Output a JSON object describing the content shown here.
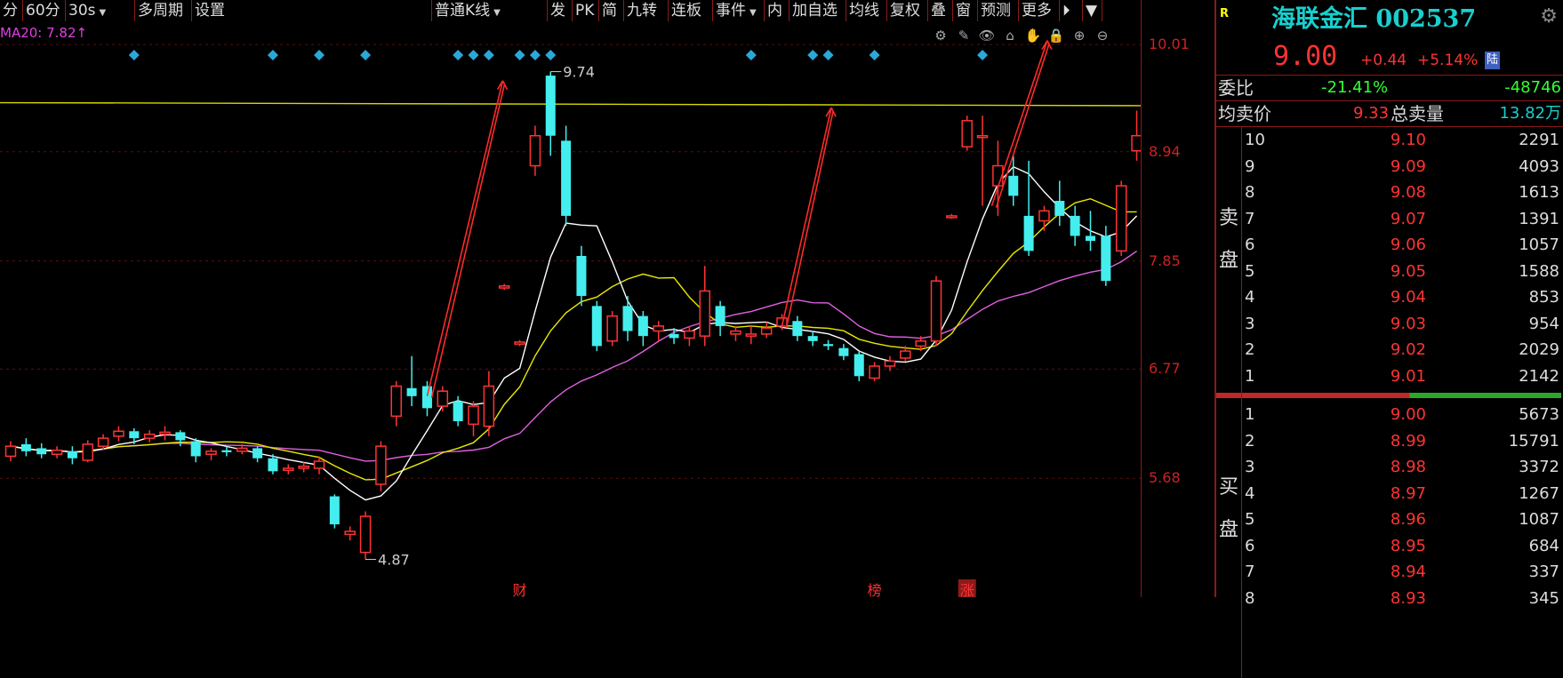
{
  "toolbar": {
    "items": [
      {
        "label": "分",
        "w": 26
      },
      {
        "label": "60分",
        "w": 48
      },
      {
        "label": "30s",
        "w": 78,
        "dd": true
      },
      {
        "label": "多周期",
        "w": 64
      },
      {
        "label": "设置",
        "w": 270
      },
      {
        "label": "普通K线",
        "w": 130,
        "dd": true
      },
      {
        "label": "发",
        "w": 28
      },
      {
        "label": "PK",
        "w": 30
      },
      {
        "label": "简",
        "w": 28
      },
      {
        "label": "九转",
        "w": 50
      },
      {
        "label": "连板",
        "w": 50
      },
      {
        "label": "事件",
        "w": 58,
        "dd": true
      },
      {
        "label": "内",
        "w": 28
      },
      {
        "label": "加自选",
        "w": 64
      },
      {
        "label": "均线",
        "w": 46
      },
      {
        "label": "复权",
        "w": 46
      },
      {
        "label": "叠",
        "w": 28
      },
      {
        "label": "窗",
        "w": 28
      },
      {
        "label": "预测",
        "w": 46
      },
      {
        "label": "更多",
        "w": 46
      },
      {
        "label": "⏵",
        "w": 26
      },
      {
        "label": "▼",
        "w": 22
      }
    ]
  },
  "ma_label": "MA20: 7.82↑",
  "tool_icons": [
    "⚙",
    "✎",
    "👁",
    "⌂",
    "✋",
    "🔒",
    "⊕",
    "⊖"
  ],
  "tool_icon_names": [
    "gear-icon",
    "pen-icon",
    "eye-icon",
    "home-icon",
    "hand-icon",
    "lock-icon",
    "zoom-in-icon",
    "zoom-out-icon"
  ],
  "axis": {
    "min": 4.6,
    "max": 10.1,
    "ticks": [
      {
        "v": 10.01,
        "label": "10.01"
      },
      {
        "v": 8.94,
        "label": "8.94"
      },
      {
        "v": 7.85,
        "label": "7.85"
      },
      {
        "v": 6.77,
        "label": "6.77"
      },
      {
        "v": 5.68,
        "label": "5.68"
      }
    ]
  },
  "chart_data": {
    "type": "candlestick",
    "colors": {
      "up": "#ff3333",
      "down": "#44eeee",
      "ma5": "#ffffff",
      "ma10": "#e8e800",
      "ma20": "#e060e0",
      "yellow_line": "#d8d800"
    },
    "high_label": "9.74",
    "low_label": "4.87",
    "event_markers": [
      "财",
      "榜",
      "涨"
    ],
    "candles": [
      [
        5.9,
        6.0,
        6.05,
        5.85
      ],
      [
        6.02,
        5.95,
        6.08,
        5.9
      ],
      [
        5.98,
        5.92,
        6.03,
        5.88
      ],
      [
        5.92,
        5.96,
        6.0,
        5.88
      ],
      [
        5.95,
        5.88,
        6.0,
        5.82
      ],
      [
        5.86,
        6.02,
        6.06,
        5.84
      ],
      [
        6.0,
        6.08,
        6.12,
        5.96
      ],
      [
        6.1,
        6.15,
        6.2,
        6.05
      ],
      [
        6.15,
        6.08,
        6.18,
        6.02
      ],
      [
        6.08,
        6.12,
        6.16,
        6.04
      ],
      [
        6.12,
        6.14,
        6.2,
        6.06
      ],
      [
        6.14,
        6.06,
        6.16,
        6.0
      ],
      [
        6.05,
        5.9,
        6.08,
        5.84
      ],
      [
        5.92,
        5.95,
        5.98,
        5.86
      ],
      [
        5.96,
        5.94,
        6.0,
        5.9
      ],
      [
        5.95,
        5.98,
        6.02,
        5.92
      ],
      [
        5.98,
        5.88,
        6.0,
        5.84
      ],
      [
        5.88,
        5.75,
        5.92,
        5.72
      ],
      [
        5.76,
        5.78,
        5.82,
        5.72
      ],
      [
        5.78,
        5.8,
        5.84,
        5.74
      ],
      [
        5.78,
        5.85,
        5.9,
        5.72
      ],
      [
        5.5,
        5.22,
        5.52,
        5.18
      ],
      [
        5.12,
        5.15,
        5.2,
        5.06
      ],
      [
        4.94,
        5.3,
        5.35,
        4.87
      ],
      [
        5.62,
        6.0,
        6.05,
        5.55
      ],
      [
        6.3,
        6.6,
        6.65,
        6.2
      ],
      [
        6.58,
        6.5,
        6.9,
        6.4
      ],
      [
        6.6,
        6.38,
        6.65,
        6.3
      ],
      [
        6.4,
        6.55,
        6.6,
        6.35
      ],
      [
        6.45,
        6.25,
        6.5,
        6.2
      ],
      [
        6.22,
        6.4,
        6.45,
        6.1
      ],
      [
        6.2,
        6.6,
        6.75,
        6.1
      ],
      [
        7.58,
        7.6,
        7.62,
        7.56
      ],
      [
        7.02,
        7.04,
        7.06,
        7.0
      ],
      [
        8.8,
        9.1,
        9.2,
        8.7
      ],
      [
        9.7,
        9.1,
        9.74,
        8.9
      ],
      [
        9.05,
        8.3,
        9.2,
        8.2
      ],
      [
        7.9,
        7.5,
        8.0,
        7.4
      ],
      [
        7.4,
        7.0,
        7.45,
        6.95
      ],
      [
        7.05,
        7.3,
        7.35,
        7.0
      ],
      [
        7.4,
        7.15,
        7.5,
        7.05
      ],
      [
        7.3,
        7.1,
        7.35,
        7.0
      ],
      [
        7.15,
        7.2,
        7.25,
        7.05
      ],
      [
        7.12,
        7.08,
        7.18,
        7.02
      ],
      [
        7.08,
        7.15,
        7.2,
        7.0
      ],
      [
        7.1,
        7.55,
        7.8,
        7.0
      ],
      [
        7.4,
        7.2,
        7.45,
        7.1
      ],
      [
        7.12,
        7.15,
        7.2,
        7.05
      ],
      [
        7.1,
        7.12,
        7.2,
        7.02
      ],
      [
        7.12,
        7.18,
        7.24,
        7.08
      ],
      [
        7.2,
        7.28,
        7.32,
        7.16
      ],
      [
        7.25,
        7.1,
        7.3,
        7.05
      ],
      [
        7.1,
        7.05,
        7.15,
        7.0
      ],
      [
        7.02,
        7.0,
        7.06,
        6.96
      ],
      [
        6.98,
        6.9,
        7.02,
        6.86
      ],
      [
        6.92,
        6.7,
        6.95,
        6.65
      ],
      [
        6.68,
        6.8,
        6.84,
        6.65
      ],
      [
        6.8,
        6.85,
        6.9,
        6.75
      ],
      [
        6.88,
        6.95,
        7.0,
        6.85
      ],
      [
        7.0,
        7.05,
        7.1,
        6.95
      ],
      [
        7.05,
        7.65,
        7.7,
        7.0
      ],
      [
        8.29,
        8.3,
        8.32,
        8.27
      ],
      [
        8.99,
        9.25,
        9.3,
        8.95
      ],
      [
        9.1,
        9.1,
        9.3,
        8.4
      ],
      [
        8.6,
        8.8,
        9.05,
        8.3
      ],
      [
        8.7,
        8.5,
        8.9,
        8.4
      ],
      [
        8.3,
        7.95,
        8.85,
        7.9
      ],
      [
        8.25,
        8.35,
        8.4,
        8.15
      ],
      [
        8.45,
        8.3,
        8.65,
        8.2
      ],
      [
        8.3,
        8.1,
        8.4,
        8.0
      ],
      [
        8.1,
        8.05,
        8.35,
        7.95
      ],
      [
        8.1,
        7.65,
        8.2,
        7.6
      ],
      [
        7.95,
        8.6,
        8.65,
        7.9
      ],
      [
        8.95,
        9.1,
        9.35,
        8.85
      ]
    ]
  },
  "panel": {
    "badge": "R",
    "name": "海联金汇",
    "code": "002537",
    "last": "9.00",
    "change": "+0.44",
    "pct": "+5.14%",
    "lu": "陆",
    "wb_label": "委比",
    "wb_pct": "-21.41%",
    "wb_diff": "-48746",
    "avg_label": "均卖价",
    "avg_val": "9.33",
    "total_label": "总卖量",
    "total_val": "13.82万",
    "sell_side": [
      "卖",
      "盘"
    ],
    "buy_side": [
      "买",
      "盘"
    ],
    "asks": [
      {
        "l": "10",
        "p": "9.10",
        "v": "2291"
      },
      {
        "l": "9",
        "p": "9.09",
        "v": "4093"
      },
      {
        "l": "8",
        "p": "9.08",
        "v": "1613"
      },
      {
        "l": "7",
        "p": "9.07",
        "v": "1391"
      },
      {
        "l": "6",
        "p": "9.06",
        "v": "1057"
      },
      {
        "l": "5",
        "p": "9.05",
        "v": "1588"
      },
      {
        "l": "4",
        "p": "9.04",
        "v": "853"
      },
      {
        "l": "3",
        "p": "9.03",
        "v": "954"
      },
      {
        "l": "2",
        "p": "9.02",
        "v": "2029"
      },
      {
        "l": "1",
        "p": "9.01",
        "v": "2142"
      }
    ],
    "bids": [
      {
        "l": "1",
        "p": "9.00",
        "v": "5673"
      },
      {
        "l": "2",
        "p": "8.99",
        "v": "15791"
      },
      {
        "l": "3",
        "p": "8.98",
        "v": "3372"
      },
      {
        "l": "4",
        "p": "8.97",
        "v": "1267"
      },
      {
        "l": "5",
        "p": "8.96",
        "v": "1087"
      },
      {
        "l": "6",
        "p": "8.95",
        "v": "684"
      },
      {
        "l": "7",
        "p": "8.94",
        "v": "337"
      },
      {
        "l": "8",
        "p": "8.93",
        "v": "345"
      }
    ],
    "bar_colors": {
      "red": "#c0282a",
      "green": "#2aa82a"
    },
    "bar_split": 0.56
  }
}
